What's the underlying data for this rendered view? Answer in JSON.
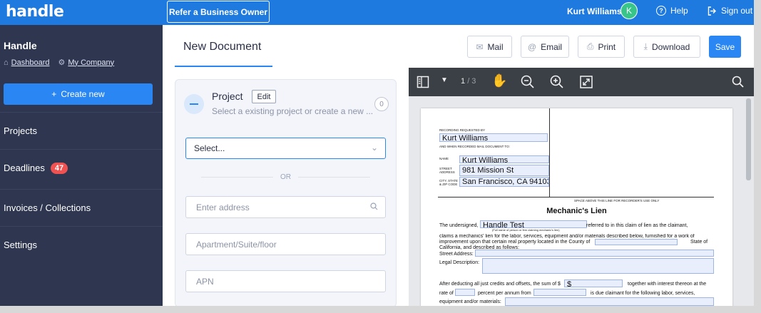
{
  "topbar": {
    "logo": "handle",
    "refer_button": "Refer a Business Owner",
    "user_name": "Kurt Williams",
    "avatar_initial": "K",
    "help": "Help",
    "signout": "Sign out",
    "color": "#1f7ae0"
  },
  "sidebar": {
    "title": "Handle",
    "breadcrumbs": {
      "dashboard": "Dashboard",
      "company": "My Company"
    },
    "create_button": "Create new",
    "items": [
      {
        "label": "Projects"
      },
      {
        "label": "Deadlines",
        "badge": "47"
      },
      {
        "label": "Invoices / Collections"
      },
      {
        "label": "Settings"
      }
    ],
    "color": "#2e3650"
  },
  "header": {
    "title": "New Document",
    "buttons": {
      "mail": "Mail",
      "email": "Email",
      "print": "Print",
      "download": "Download",
      "save": "Save"
    }
  },
  "project_form": {
    "title": "Project",
    "edit_label": "Edit",
    "subtitle": "Select a existing project or create a new ...",
    "count": "0",
    "select_value": "Select...",
    "or_label": "OR",
    "address_placeholder": "Enter address",
    "apartment_placeholder": "Apartment/Suite/floor",
    "apn_placeholder": "APN"
  },
  "viewer": {
    "current_page": "1",
    "total_pages": "/ 3",
    "icons": [
      "sidebar-toggle-icon",
      "chevron-down-icon",
      "hand-pan-icon",
      "zoom-out-icon",
      "zoom-in-icon",
      "fullscreen-icon",
      "search-icon"
    ]
  },
  "pdf": {
    "recording_requested_by": "RECORDING REQUESTED BY",
    "requested_by_value": "Kurt Williams",
    "mail_to_label": "AND WHEN RECORDED MAIL DOCUMENT TO:",
    "name_label": "NAME",
    "name_value": "Kurt Williams",
    "street_label": "STREET ADDRESS",
    "street_value": "981  Mission St",
    "city_label": "CITY, STATE & ZIP CODE",
    "city_value": "San Francisco, CA 94103",
    "space_above": "SPACE ABOVE THIS LINE FOR RECORDER'S USE ONLY",
    "heading": "Mechanic's Lien",
    "undersigned_prefix": "The undersigned,",
    "claimant_value": "Handle Test",
    "claimant_suffix": "referred to in this claim of lien as the claimant,",
    "claimant_hint": "(Full name of person or firm claiming mechanic's lien)",
    "claims_line1": "claims a mechanics' lien for the labor, services, equipment and/or materials described below, furnished for a work of",
    "claims_line2": "improvement upon that certain real property located in the County of",
    "state_label": "State of",
    "claims_line3": "California, and described as follows:",
    "street_address_label": "Street Address:",
    "legal_description_label": "Legal Description:",
    "after_deducting": "After deducting all just credits and offsets, the sum of $",
    "sum_value": "$",
    "together_with": "together with interest thereon at the",
    "rate_of": "rate of",
    "percent_per_annum": "percent per annum from",
    "due_claimant": "is due claimant for the following labor, services,",
    "equipment_materials": "equipment and/or materials:"
  }
}
